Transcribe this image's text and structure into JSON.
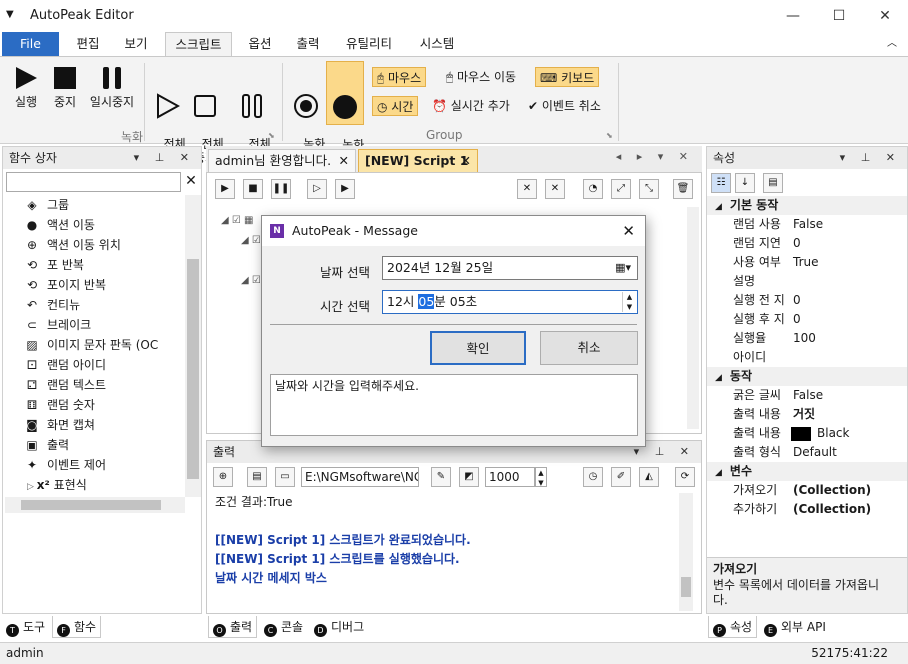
{
  "window": {
    "title": "AutoPeak Editor",
    "minimize": "—",
    "maximize": "☐",
    "close": "✕"
  },
  "ribbon_tabs": [
    "File",
    "편집",
    "보기",
    "스크립트",
    "옵션",
    "출력",
    "유틸리티",
    "시스템"
  ],
  "ribbon": {
    "record_buttons": [
      {
        "label": "실행",
        "icon": "play-icon"
      },
      {
        "label": "중지",
        "icon": "stop-icon"
      },
      {
        "label": "일시중지",
        "icon": "pause-icon"
      },
      {
        "label": "전체\n실행",
        "icon": "play-outline-icon"
      },
      {
        "label": "전체\n중지",
        "icon": "stop-outline-icon"
      },
      {
        "label": "전체\n일시중지",
        "icon": "pause-outline-icon"
      }
    ],
    "record_group_label": "녹화",
    "capture_buttons": [
      {
        "label": "녹화\n시작",
        "icon": "record-icon"
      },
      {
        "label": "녹화\n중지",
        "icon": "record-stop-icon"
      }
    ],
    "group_items": [
      {
        "label": "마우스",
        "icon": "mouse-icon",
        "highlighted": true
      },
      {
        "label": "마우스 이동",
        "icon": "mouse-move-icon",
        "highlighted": false
      },
      {
        "label": "키보드",
        "icon": "keyboard-icon",
        "highlighted": true
      },
      {
        "label": "시간",
        "icon": "clock-icon",
        "highlighted": true
      },
      {
        "label": "실시간 추가",
        "icon": "alarm-icon",
        "highlighted": false
      },
      {
        "label": "이벤트 취소",
        "icon": "check-circle-icon",
        "highlighted": false
      }
    ],
    "group_label": "Group"
  },
  "left_panel": {
    "title": "함수 상자",
    "items": [
      {
        "label": "그룹",
        "icon": "group-icon"
      },
      {
        "label": "액션 이동",
        "icon": "action-move-icon"
      },
      {
        "label": "액션 이동 위치",
        "icon": "action-position-icon"
      },
      {
        "label": "포 반복",
        "icon": "for-loop-icon"
      },
      {
        "label": "포이지 반복",
        "icon": "foreach-loop-icon"
      },
      {
        "label": "컨티뉴",
        "icon": "continue-icon"
      },
      {
        "label": "브레이크",
        "icon": "break-icon"
      },
      {
        "label": "이미지 문자 판독 (OC",
        "icon": "ocr-icon"
      },
      {
        "label": "랜덤 아이디",
        "icon": "random-id-icon"
      },
      {
        "label": "랜덤 텍스트",
        "icon": "random-text-icon"
      },
      {
        "label": "랜덤 숫자",
        "icon": "random-number-icon"
      },
      {
        "label": "화면 캡쳐",
        "icon": "camera-icon"
      },
      {
        "label": "출력",
        "icon": "console-icon"
      },
      {
        "label": "이벤트 제어",
        "icon": "event-icon"
      }
    ],
    "collapsed_item": "표현식",
    "tabs": [
      {
        "label": "도구",
        "key": "T"
      },
      {
        "label": "함수",
        "key": "F"
      }
    ]
  },
  "doc_tabs": [
    {
      "label": "admin님 환영합니다.",
      "active": false
    },
    {
      "label": "[NEW] Script 1",
      "active": true
    }
  ],
  "output": {
    "title": "출력",
    "path": "E:\\NGMsoftware\\NG",
    "count": "1000",
    "lines": [
      {
        "text": "조건 결과:True",
        "style": "normal"
      },
      {
        "text": "[[NEW] Script 1] 스크립트가 완료되었습니다.",
        "style": "blue"
      },
      {
        "text": "[[NEW] Script 1] 스크립트를 실행했습니다.",
        "style": "blue"
      },
      {
        "text": "날짜 시간 메세지 박스",
        "style": "blue"
      }
    ],
    "tabs": [
      {
        "label": "출력",
        "key": "O"
      },
      {
        "label": "콘솔",
        "key": "C"
      },
      {
        "label": "디버그",
        "key": "D"
      }
    ]
  },
  "properties": {
    "title": "속성",
    "categories": [
      {
        "name": "기본 동작",
        "rows": [
          {
            "k": "랜덤 사용",
            "v": "False"
          },
          {
            "k": "랜덤 지연",
            "v": "0"
          },
          {
            "k": "사용 여부",
            "v": "True"
          },
          {
            "k": "설명",
            "v": ""
          },
          {
            "k": "실행 전 지",
            "v": "0"
          },
          {
            "k": "실행 후 지",
            "v": "0"
          },
          {
            "k": "실행율",
            "v": "100"
          },
          {
            "k": "아이디",
            "v": ""
          }
        ]
      },
      {
        "name": "동작",
        "rows": [
          {
            "k": "굵은 글씨",
            "v": "False"
          },
          {
            "k": "출력 내용",
            "v": "거짓"
          },
          {
            "k": "출력 내용",
            "v": "Black"
          },
          {
            "k": "출력 형식",
            "v": "Default"
          }
        ]
      },
      {
        "name": "변수",
        "rows": [
          {
            "k": "가져오기",
            "v": "(Collection)"
          },
          {
            "k": "추가하기",
            "v": "(Collection)"
          }
        ]
      }
    ],
    "help_title": "가져오기",
    "help_text": "변수 목록에서 데이터를 가져옵니\n다.",
    "tabs": [
      {
        "label": "속성",
        "key": "P"
      },
      {
        "label": "외부 API",
        "key": "E"
      }
    ]
  },
  "dialog": {
    "title": "AutoPeak - Message",
    "date_label": "날짜 선택",
    "date_value": "2024년 12월 25일",
    "time_label": "시간 선택",
    "time_h": "12시 ",
    "time_m": "05",
    "time_rest": "분 05초",
    "ok": "확인",
    "cancel": "취소",
    "message": "날짜와 시간을 입력해주세요."
  },
  "status": {
    "user": "admin",
    "clock": "52175:41:22"
  },
  "colors": {
    "accent": "#2b6cc4",
    "highlight": "#fbd98a",
    "output_blue": "#1a3ea8"
  }
}
